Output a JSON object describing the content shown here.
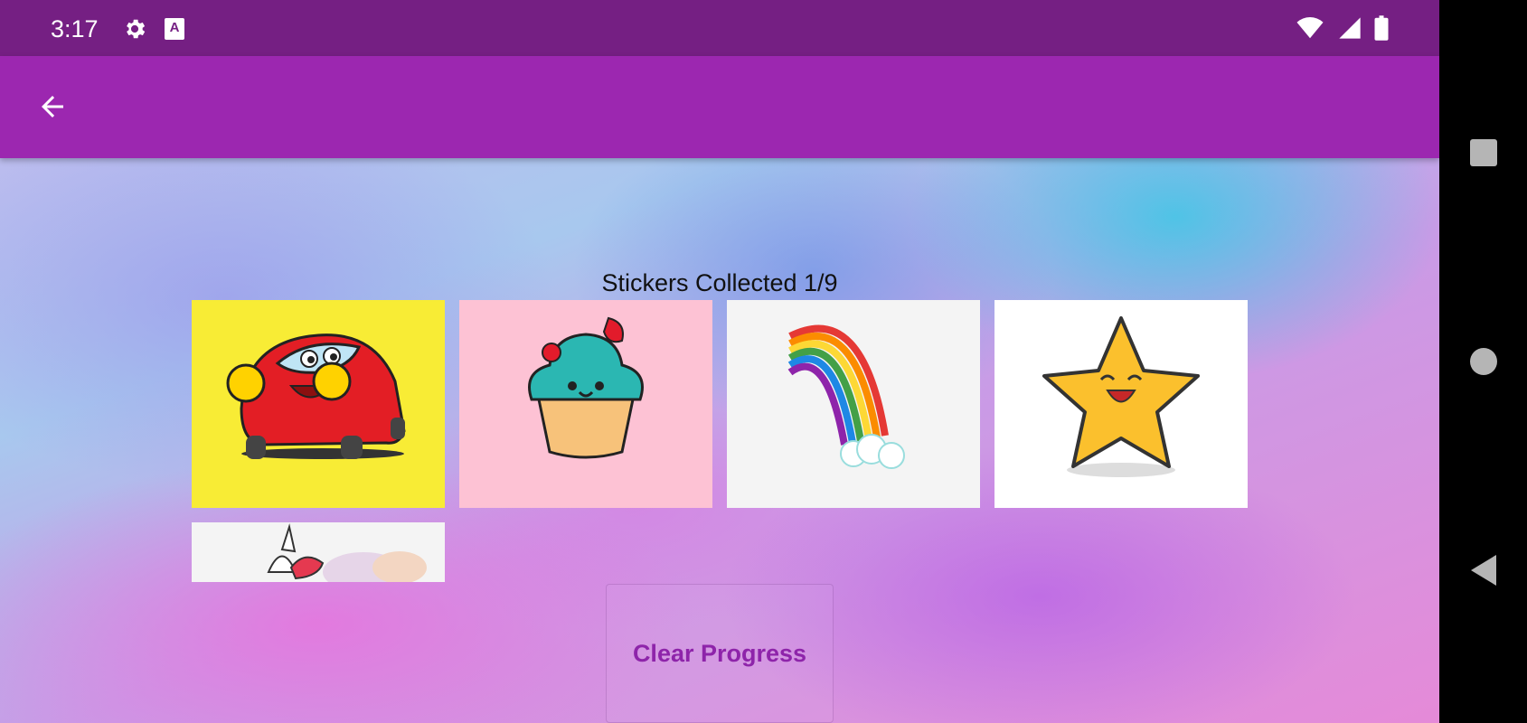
{
  "status_bar": {
    "time": "3:17",
    "left_icons": [
      "gear-icon",
      "accessibility-a-icon"
    ],
    "right_icons": [
      "wifi-icon",
      "signal-icon",
      "battery-icon"
    ],
    "a_glyph": "A"
  },
  "app_bar": {
    "back_icon": "arrow-back-icon",
    "color": "#9c27b0",
    "status_color": "#751f83"
  },
  "main": {
    "title": "Stickers Collected 1/9",
    "stickers": [
      {
        "name": "car",
        "background": "#f8ec35"
      },
      {
        "name": "cupcake",
        "background": "#fdc2d4"
      },
      {
        "name": "rainbow",
        "background": "#f4f4f4"
      },
      {
        "name": "star",
        "background": "#ffffff"
      },
      {
        "name": "unicorn",
        "background": "#f4f4f4"
      }
    ],
    "clear_button_label": "Clear Progress",
    "accent_color": "#8e24aa"
  },
  "nav_bar": {
    "icons": [
      "recents-square-icon",
      "home-circle-icon",
      "back-triangle-icon"
    ]
  }
}
